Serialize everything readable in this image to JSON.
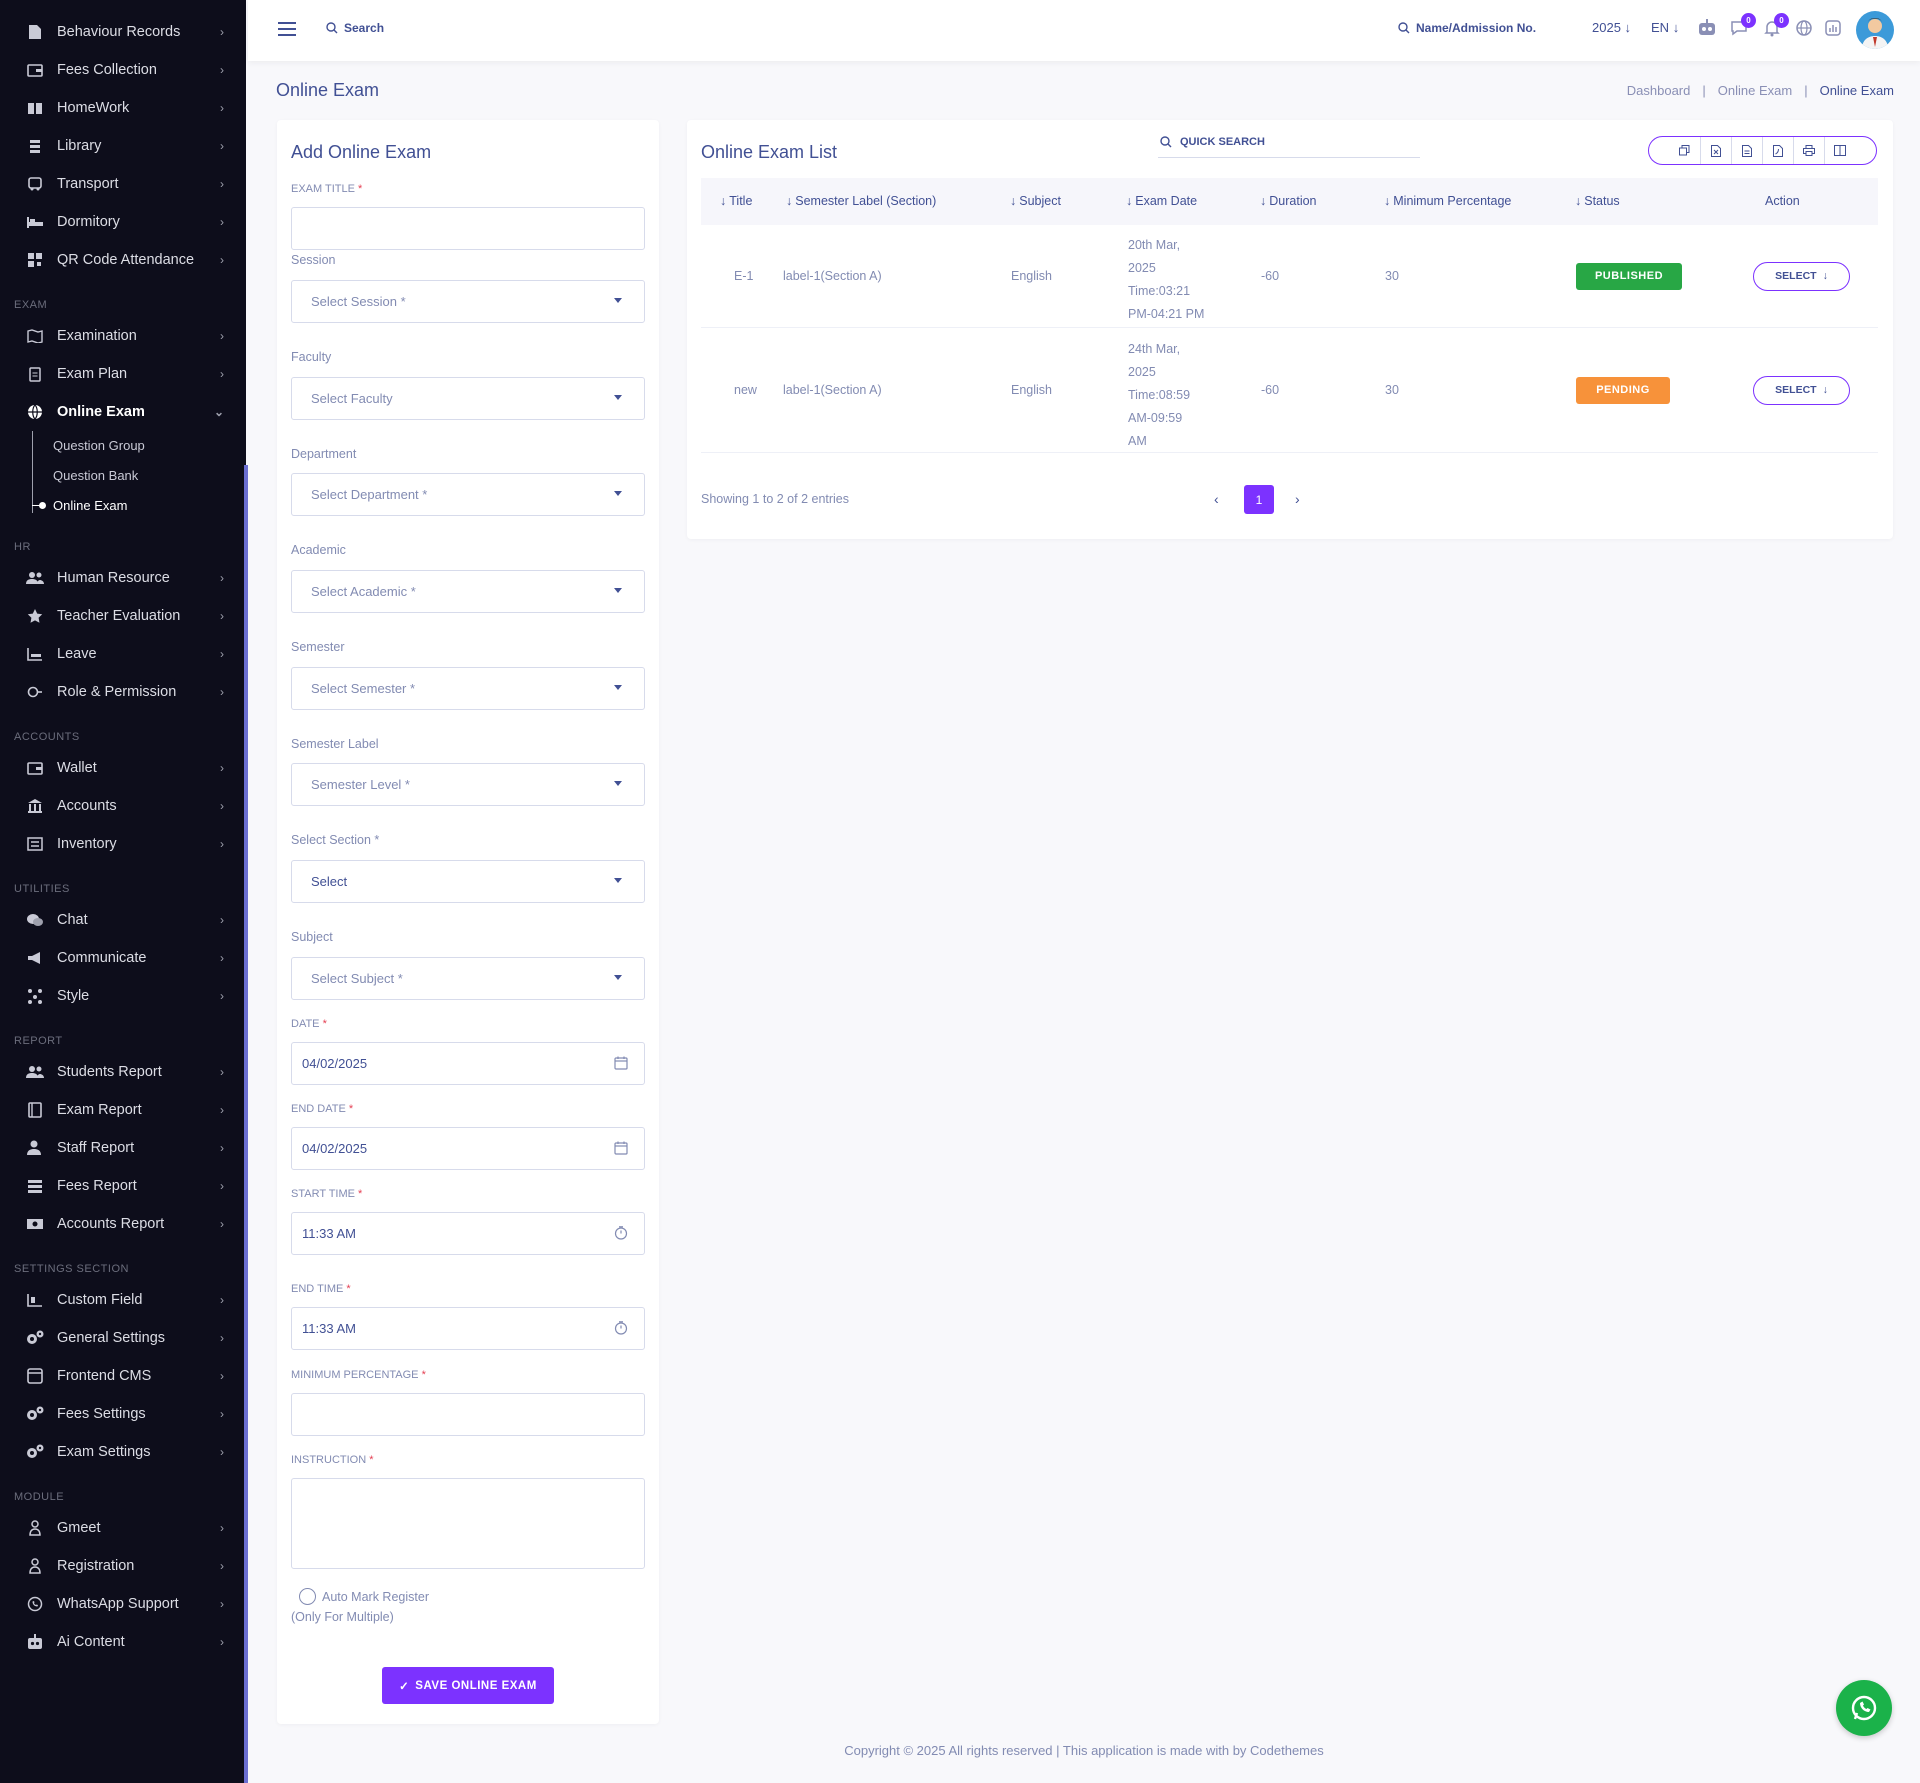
{
  "sidebar": {
    "items_top": [
      {
        "label": "Behaviour Records",
        "icon": "file-icon"
      },
      {
        "label": "Fees Collection",
        "icon": "wallet-icon"
      },
      {
        "label": "HomeWork",
        "icon": "book-icon"
      },
      {
        "label": "Library",
        "icon": "library-icon"
      },
      {
        "label": "Transport",
        "icon": "bus-icon"
      },
      {
        "label": "Dormitory",
        "icon": "bed-icon"
      },
      {
        "label": "QR Code Attendance",
        "icon": "qr-icon"
      }
    ],
    "exam_group": "EXAM",
    "exam_items": [
      {
        "label": "Examination",
        "icon": "map-icon"
      },
      {
        "label": "Exam Plan",
        "icon": "clipboard-icon"
      },
      {
        "label": "Online Exam",
        "icon": "globe-icon"
      }
    ],
    "online_exam_sub": [
      "Question Group",
      "Question Bank",
      "Online Exam"
    ],
    "hr_group": "HR",
    "hr_items": [
      {
        "label": "Human Resource",
        "icon": "users-icon"
      },
      {
        "label": "Teacher Evaluation",
        "icon": "star-icon"
      },
      {
        "label": "Leave",
        "icon": "leave-icon"
      },
      {
        "label": "Role & Permission",
        "icon": "key-icon"
      }
    ],
    "accounts_group": "ACCOUNTS",
    "accounts_items": [
      {
        "label": "Wallet",
        "icon": "wallet-icon"
      },
      {
        "label": "Accounts",
        "icon": "bank-icon"
      },
      {
        "label": "Inventory",
        "icon": "inventory-icon"
      }
    ],
    "utilities_group": "UTILITIES",
    "utilities_items": [
      {
        "label": "Chat",
        "icon": "chat-icon"
      },
      {
        "label": "Communicate",
        "icon": "megaphone-icon"
      },
      {
        "label": "Style",
        "icon": "style-icon"
      }
    ],
    "report_group": "REPORT",
    "report_items": [
      {
        "label": "Students Report",
        "icon": "users-icon"
      },
      {
        "label": "Exam Report",
        "icon": "report-icon"
      },
      {
        "label": "Staff Report",
        "icon": "staff-icon"
      },
      {
        "label": "Fees Report",
        "icon": "list-icon"
      },
      {
        "label": "Accounts Report",
        "icon": "money-icon"
      }
    ],
    "settings_group": "SETTINGS SECTION",
    "settings_items": [
      {
        "label": "Custom Field",
        "icon": "field-icon"
      },
      {
        "label": "General Settings",
        "icon": "gears-icon"
      },
      {
        "label": "Frontend CMS",
        "icon": "cms-icon"
      },
      {
        "label": "Fees Settings",
        "icon": "gears-icon"
      },
      {
        "label": "Exam Settings",
        "icon": "gears-icon"
      }
    ],
    "module_group": "MODULE",
    "module_items": [
      {
        "label": "Gmeet",
        "icon": "user-icon"
      },
      {
        "label": "Registration",
        "icon": "user-icon"
      },
      {
        "label": "WhatsApp Support",
        "icon": "whatsapp-icon"
      },
      {
        "label": "Ai Content",
        "icon": "robot-icon"
      }
    ]
  },
  "header": {
    "search_label": "Search",
    "name_search": "Name/Admission No.",
    "year": "2025",
    "lang": "EN",
    "chat_count": "0",
    "notif_count": "0"
  },
  "page": {
    "title": "Online Exam",
    "breadcrumb": [
      "Dashboard",
      "Online Exam",
      "Online Exam"
    ]
  },
  "form": {
    "title": "Add Online Exam",
    "exam_title_label": "EXAM TITLE",
    "session_label": "Session",
    "session_ph": "Select Session *",
    "faculty_label": "Faculty",
    "faculty_ph": "Select Faculty",
    "department_label": "Department",
    "department_ph": "Select Department *",
    "academic_label": "Academic",
    "academic_ph": "Select Academic *",
    "semester_label": "Semester",
    "semester_ph": "Select Semester *",
    "semlabel_label": "Semester Label",
    "semlabel_ph": "Semester Level *",
    "section_label": "Select Section *",
    "section_ph": "Select",
    "subject_label": "Subject",
    "subject_ph": "Select Subject *",
    "date_label": "DATE",
    "date_val": "04/02/2025",
    "end_date_label": "END DATE",
    "end_date_val": "04/02/2025",
    "start_time_label": "START TIME",
    "start_time_val": "11:33 AM",
    "end_time_label": "END TIME",
    "end_time_val": "11:33 AM",
    "min_pct_label": "MINIMUM PERCENTAGE",
    "instruction_label": "INSTRUCTION",
    "auto_mark": "Auto Mark Register",
    "auto_mark_note": "(Only For Multiple)",
    "save_label": "SAVE ONLINE EXAM"
  },
  "list": {
    "title": "Online Exam List",
    "quick_search": "QUICK SEARCH",
    "columns": [
      "Title",
      "Semester Label (Section)",
      "Subject",
      "Exam Date",
      "Duration",
      "Minimum Percentage",
      "Status",
      "Action"
    ],
    "rows": [
      {
        "title": "E-1",
        "label": "label-1(Section A)",
        "subject": "English",
        "date_lines": [
          "20th Mar,",
          "2025",
          "Time:03:21",
          "PM-04:21 PM"
        ],
        "duration": "-60",
        "min_pct": "30",
        "status": "PUBLISHED",
        "status_color": "#28a745",
        "action": "SELECT"
      },
      {
        "title": "new",
        "label": "label-1(Section A)",
        "subject": "English",
        "date_lines": [
          "24th Mar,",
          "2025",
          "Time:08:59",
          "AM-09:59",
          "AM"
        ],
        "duration": "-60",
        "min_pct": "30",
        "status": "PENDING",
        "status_color": "#f7923a",
        "action": "SELECT"
      }
    ],
    "showing": "Showing 1 to 2 of 2 entries",
    "page": "1"
  },
  "footer": "Copyright © 2025 All rights reserved | This application is made with by Codethemes",
  "colors": {
    "accent": "#7c32ff",
    "sidebar_bg": "#0d0d1b",
    "text": "#415094"
  }
}
